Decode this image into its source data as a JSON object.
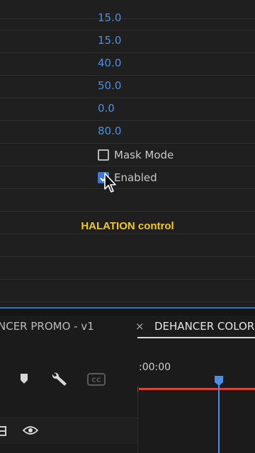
{
  "effect_controls": {
    "values": [
      "15.0",
      "15.0",
      "40.0",
      "50.0",
      "0.0",
      "80.0"
    ],
    "mask_mode_label": "Mask Mode",
    "mask_mode_checked": false,
    "enabled_label": "Enabled",
    "enabled_checked": true
  },
  "caption": "HALATION control",
  "timeline": {
    "left_tab": "NCER PROMO - v1",
    "close_glyph": "×",
    "right_tab": "DEHANCER COLOR",
    "timecode": ":00:00",
    "tools": [
      "marker-icon",
      "wrench-icon",
      "cc-icon"
    ],
    "colors": {
      "accent": "#4a8fe6",
      "value_blue": "#4b8ee6",
      "caption_yellow": "#f2c81a",
      "work_area": "#d9433c"
    }
  }
}
